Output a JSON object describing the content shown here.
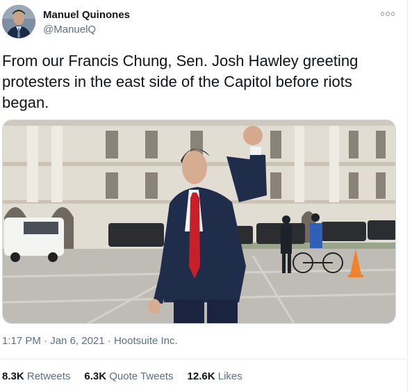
{
  "author": {
    "name": "Manuel Quinones",
    "handle": "@ManuelQ"
  },
  "tweet": {
    "text": "From our Francis Chung, Sen. Josh Hawley greeting protesters in the east side of the Capitol before riots began.",
    "time": "1:17 PM",
    "date": "Jan 6, 2021",
    "source": "Hootsuite Inc."
  },
  "stats": {
    "retweets_count": "8.3K",
    "retweets_label": "Retweets",
    "quote_count": "6.3K",
    "quote_label": "Quote Tweets",
    "likes_count": "12.6K",
    "likes_label": "Likes"
  },
  "icons": {
    "more": "more-options-icon"
  },
  "colors": {
    "text": "#0f1419",
    "secondary": "#5b7083",
    "border": "#e6ecf0"
  }
}
